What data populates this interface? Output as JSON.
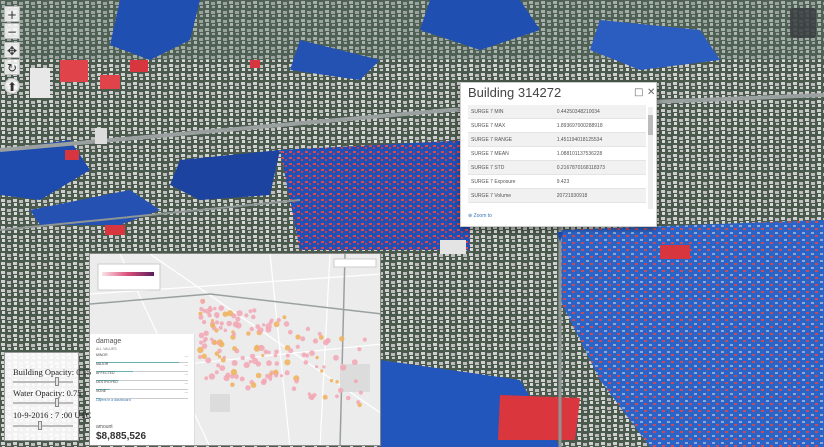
{
  "map_controls": {
    "zoom_in": "+",
    "zoom_out": "−",
    "pan": "✥",
    "rotate": "↻",
    "compass": "⬆"
  },
  "popup": {
    "title": "Building 314272",
    "maximize_icon": "□",
    "close_icon": "✕",
    "rows": [
      {
        "label": "SURGE 7 MIN",
        "value": "0.44250348210034"
      },
      {
        "label": "SURGE 7 MAX",
        "value": "1.893697000288918"
      },
      {
        "label": "SURGE 7 RANGE",
        "value": "1.451194018125534"
      },
      {
        "label": "SURGE 7 MEAN",
        "value": "1.088101137536228"
      },
      {
        "label": "SURGE 7 STD",
        "value": "0.2167870168118373"
      },
      {
        "label": "SURGE 7 Exposure",
        "value": "9.423"
      },
      {
        "label": "SURGE 7 Volume",
        "value": "20721930918"
      }
    ],
    "zoom_to": "Zoom to"
  },
  "dashboard": {
    "side": {
      "heading": "damage",
      "subheading": "ALL VALUES",
      "rows": [
        {
          "label": "MINOR",
          "count": "—",
          "fill": 0.9
        },
        {
          "label": "MAJOR",
          "count": "—",
          "fill": 0.4
        },
        {
          "label": "AFFECTED",
          "count": "—",
          "fill": 0.25
        },
        {
          "label": "DESTROYED",
          "count": "—",
          "fill": 0.15
        },
        {
          "label": "NONE",
          "count": "—",
          "fill": 0.05
        }
      ],
      "link": "Layers in a dashboard",
      "amount_label": "amount",
      "amount_value": "$8,885,526"
    }
  },
  "controls": {
    "building_opacity": "Building Opacity: 0.75",
    "water_opacity": "Water Opacity: 0.75",
    "time": "10-9-2016 : 7 :00 UTC",
    "building_opacity_value": 0.75,
    "water_opacity_value": 0.75,
    "time_value": 0.45
  },
  "colors": {
    "water": "#1d4fb8",
    "flooded_building": "#d9363e",
    "land": "#4c5d4e",
    "dashboard_point": "#f2a7b4"
  }
}
